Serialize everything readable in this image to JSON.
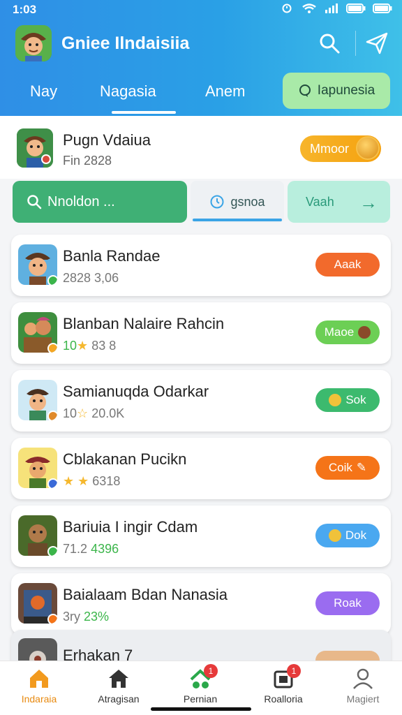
{
  "status_bar": {
    "time": "1:03"
  },
  "header": {
    "app_title": "Gniee Ilndaisiia",
    "tabs": [
      {
        "label": "Nay"
      },
      {
        "label": "Nagasia"
      },
      {
        "label": "Anem"
      }
    ],
    "pill_label": "Iapunesia"
  },
  "profile": {
    "name": "Pugn Vdaiua",
    "sub": "Fin 2828",
    "button_label": "Mmoor"
  },
  "actions": {
    "search_label": "Nnoldon ...",
    "genre_label": "gsnoa",
    "next_label": "Vaah"
  },
  "games": [
    {
      "title": "Banla Randae",
      "sub": "2828 3,06",
      "button": "Aaak",
      "button_color": "#f26a2c"
    },
    {
      "title": "Blanban Nalaire Rahcin",
      "sub_prefix": "10",
      "sub_suffix": "83 8",
      "button": "Maoe",
      "button_color": "#6ccf55"
    },
    {
      "title": "Samianuqda Odarkar",
      "sub_prefix": "10",
      "sub_suffix": "20.0K",
      "button": "Sok",
      "button_color": "#3cba6e"
    },
    {
      "title": "Cblakanan Pucikn",
      "sub_suffix": "6318",
      "button": "Coik",
      "button_color": "#f57418"
    },
    {
      "title": "Bariuia I ingir Cdam",
      "sub_prefix": "71.2",
      "sub_highlight": "4396",
      "button": "Dok",
      "button_color": "#4aa8f0"
    },
    {
      "title": "Baialaam Bdan Nanasia",
      "sub_prefix": "3ry",
      "sub_highlight": "23%",
      "button": "Roak",
      "button_color": "#9a6cf0"
    },
    {
      "title": "Erhakan 7"
    }
  ],
  "bottom_nav": [
    {
      "label": "Indaraia",
      "active_color": "#f29a1e"
    },
    {
      "label": "Atragisan"
    },
    {
      "label": "Pernian",
      "badge": "1"
    },
    {
      "label": "Roalloria",
      "badge": "1"
    },
    {
      "label": "Magiert"
    }
  ],
  "colors": {
    "header_start": "#2f8fe6",
    "header_end": "#3fc0e8",
    "search_green": "#3fb075",
    "accent_blue": "#3aa4e6"
  },
  "icons": [
    "search-icon",
    "send-icon",
    "clock-icon",
    "arrow-right-icon",
    "home-icon",
    "house-icon",
    "gift-icon",
    "box-icon",
    "user-icon"
  ]
}
